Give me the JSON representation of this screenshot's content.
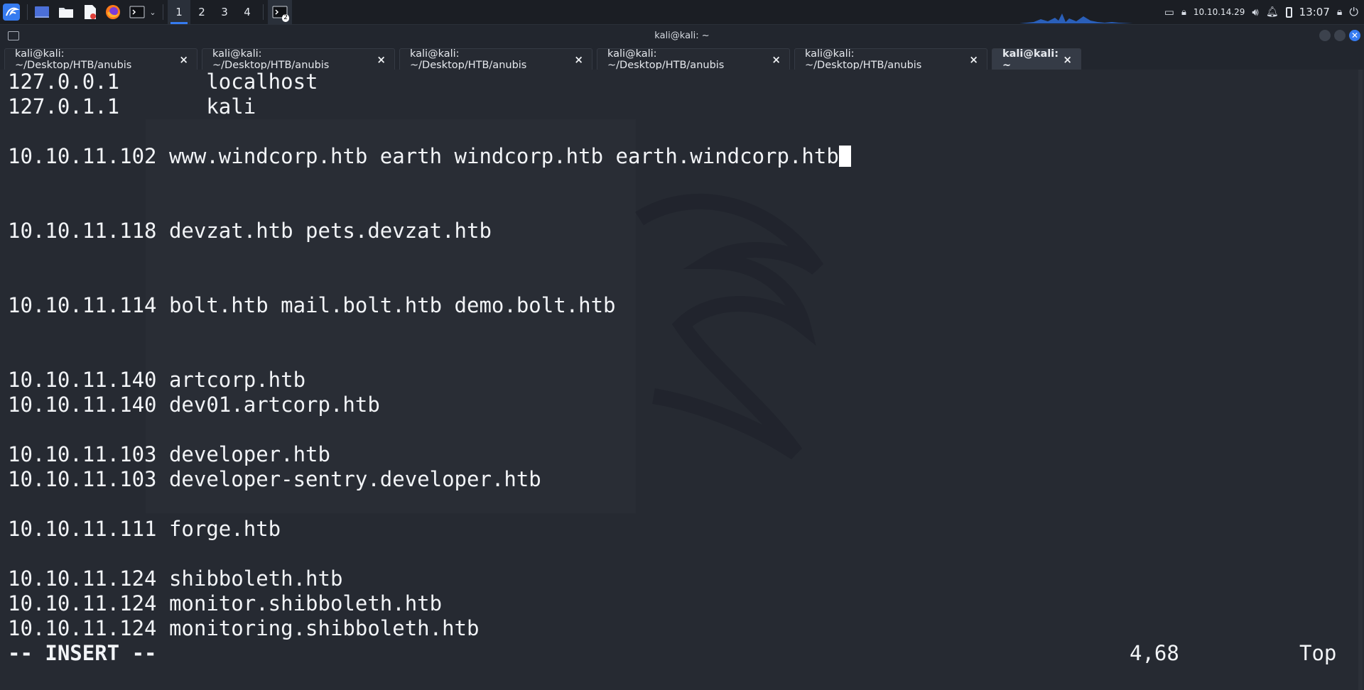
{
  "taskbar": {
    "workspaces": [
      "1",
      "2",
      "3",
      "4"
    ],
    "active_workspace": "1",
    "terminal_badge": "2",
    "ip_address": "10.10.14.29",
    "clock": "13:07"
  },
  "window": {
    "title": "kali@kali: ~"
  },
  "tabs": [
    {
      "label": "kali@kali: ~/Desktop/HTB/anubis",
      "close": "×"
    },
    {
      "label": "kali@kali: ~/Desktop/HTB/anubis",
      "close": "×"
    },
    {
      "label": "kali@kali: ~/Desktop/HTB/anubis",
      "close": "×"
    },
    {
      "label": "kali@kali: ~/Desktop/HTB/anubis",
      "close": "×"
    },
    {
      "label": "kali@kali: ~/Desktop/HTB/anubis",
      "close": "×"
    },
    {
      "label": "kali@kali: ~",
      "close": "×"
    }
  ],
  "editor": {
    "lines": [
      "127.0.0.1       localhost",
      "127.0.1.1       kali",
      "",
      "10.10.11.102 www.windcorp.htb earth windcorp.htb earth.windcorp.htb",
      "",
      "",
      "10.10.11.118 devzat.htb pets.devzat.htb",
      "",
      "",
      "10.10.11.114 bolt.htb mail.bolt.htb demo.bolt.htb",
      "",
      "",
      "10.10.11.140 artcorp.htb",
      "10.10.11.140 dev01.artcorp.htb",
      "",
      "10.10.11.103 developer.htb",
      "10.10.11.103 developer-sentry.developer.htb",
      "",
      "10.10.11.111 forge.htb",
      "",
      "10.10.11.124 shibboleth.htb",
      "10.10.11.124 monitor.shibboleth.htb",
      "10.10.11.124 monitoring.shibboleth.htb"
    ],
    "mode": "-- INSERT --",
    "cursor_position": "4,68",
    "scroll_position": "Top"
  }
}
